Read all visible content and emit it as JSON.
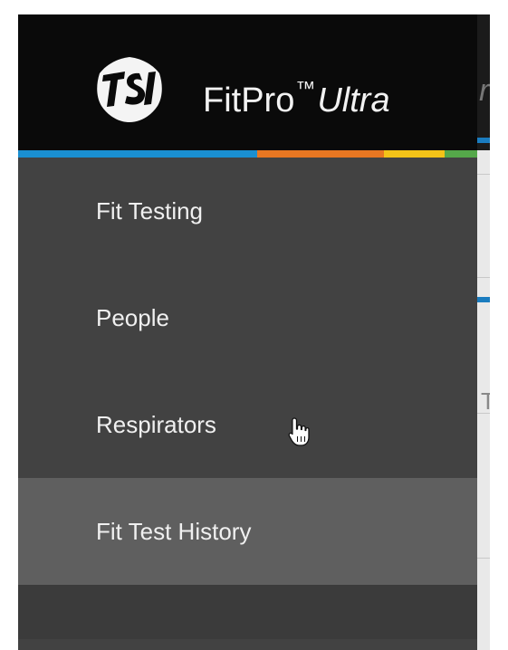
{
  "app": {
    "brand_name": "FitPro",
    "brand_tm": "™",
    "brand_suffix": "Ultra",
    "logo_icon": "tsi-logo-icon"
  },
  "header_colors": {
    "header_bg": "#0a0a0a",
    "drawer_bg": "#424242",
    "selected_bg": "#5f5f5f",
    "stripe": [
      "#1a8fd1",
      "#e87722",
      "#f3c318",
      "#55a84a"
    ]
  },
  "nav": {
    "items": [
      {
        "label": "Fit Testing",
        "selected": false
      },
      {
        "label": "People",
        "selected": false
      },
      {
        "label": "Respirators",
        "selected": false
      },
      {
        "label": "Fit Test History",
        "selected": true
      }
    ]
  },
  "background_app": {
    "header_fragment": "ra",
    "body_fragment": "TE"
  },
  "cursor": {
    "icon": "hand-pointer-icon"
  }
}
